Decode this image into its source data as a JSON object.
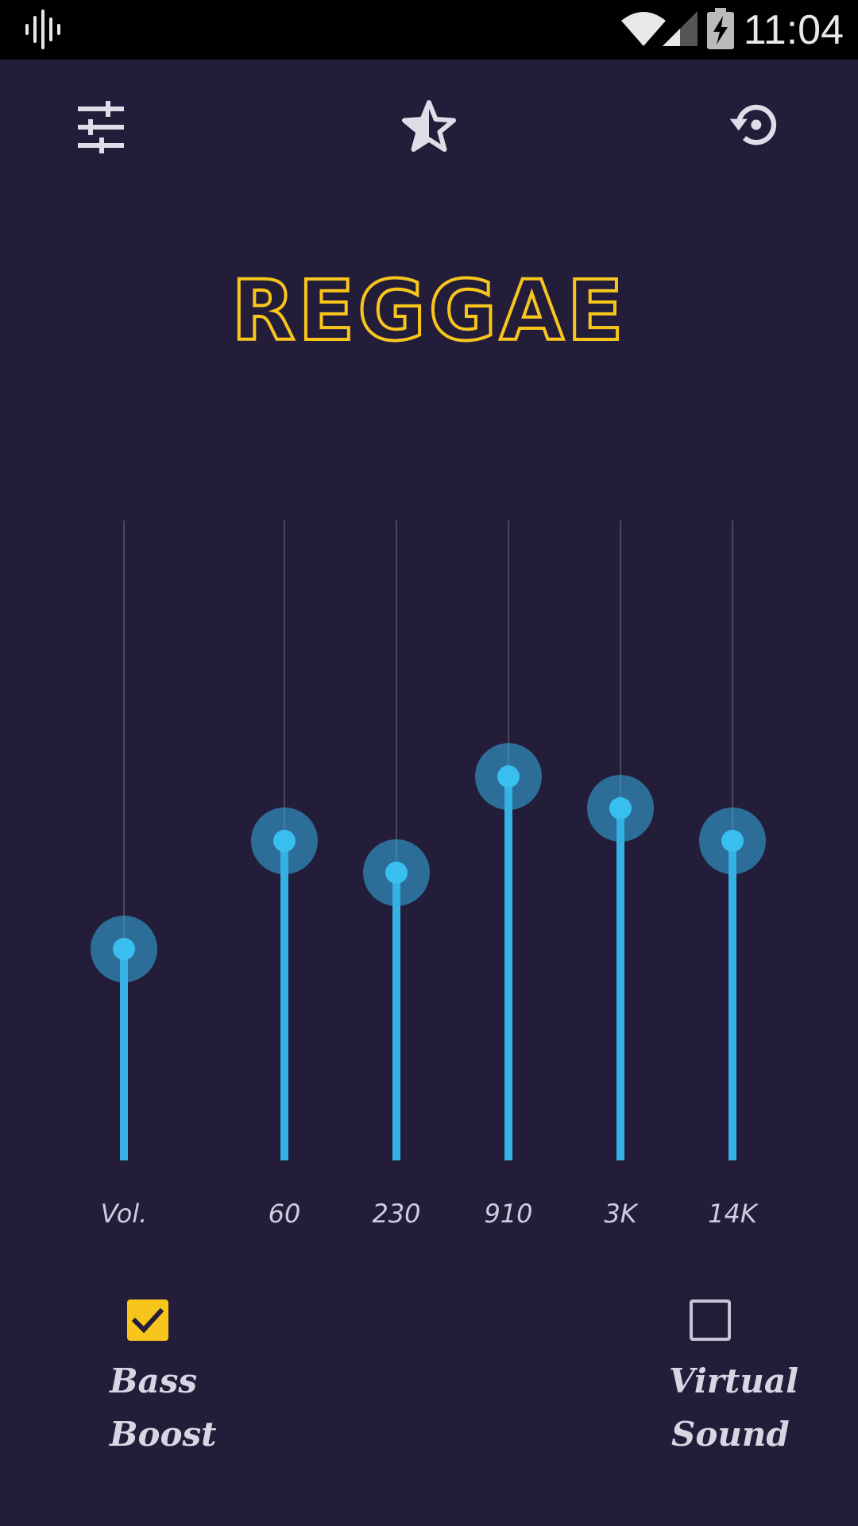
{
  "status_bar": {
    "time": "11:04",
    "icons": [
      "waveform-icon",
      "wifi-icon",
      "cell-signal-icon",
      "battery-charging-icon"
    ]
  },
  "toolbar": {
    "icons": [
      "sliders-icon",
      "star-icon",
      "restore-icon"
    ]
  },
  "preset": {
    "name": "REGGAE",
    "color": "#f8c51c"
  },
  "equalizer": {
    "accent_color": "#35b1e6",
    "bands": [
      {
        "label": "Vol.",
        "level": 0.33
      },
      {
        "label": "60",
        "level": 0.5
      },
      {
        "label": "230",
        "level": 0.45
      },
      {
        "label": "910",
        "level": 0.6
      },
      {
        "label": "3K",
        "level": 0.55
      },
      {
        "label": "14K",
        "level": 0.5
      }
    ]
  },
  "toggles": {
    "bass_boost": {
      "line1": "Bass",
      "line2": "Boost",
      "checked": true
    },
    "virtual_sound": {
      "line1": "Virtual",
      "line2": "Sound",
      "checked": false
    }
  }
}
